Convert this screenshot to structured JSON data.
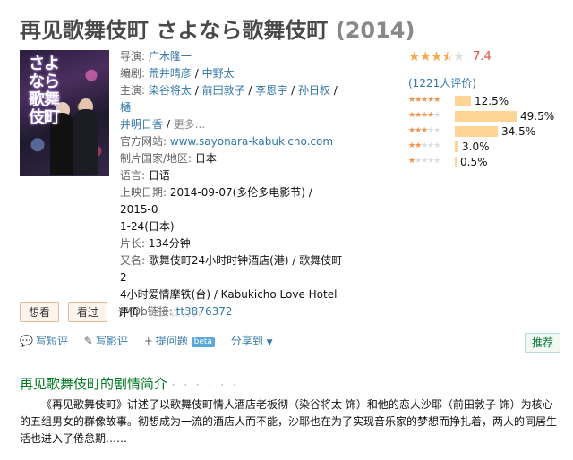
{
  "title": {
    "main": "再见歌舞伎町 さよなら歌舞伎町",
    "year": "(2014)"
  },
  "poster": {
    "text": "さよなら歌舞伎町"
  },
  "info": {
    "director_label": "导演:",
    "director": "广木隆一",
    "writer_label": "编剧:",
    "writers": [
      "荒井晴彦",
      "中野太"
    ],
    "cast_label": "主演:",
    "cast_line1": [
      "染谷将太",
      "前田敦子",
      "李恩宇",
      "孙日权",
      "樋"
    ],
    "cast_line2": [
      "井明日香"
    ],
    "cast_more": "更多...",
    "site_label": "官方网站:",
    "site": "www.sayonara-kabukicho.com",
    "country_label": "制片国家/地区:",
    "country": "日本",
    "lang_label": "语言:",
    "lang": "日语",
    "release_label": "上映日期:",
    "release_line1": "2014-09-07(多伦多电影节) / 2015-0",
    "release_line2": "1-24(日本)",
    "runtime_label": "片长:",
    "runtime": "134分钟",
    "aka_label": "又名:",
    "aka_line1": "歌舞伎町24小时时钟酒店(港) / 歌舞伎町2",
    "aka_line2": "4小时爱情摩铁(台) / Kabukicho Love Hotel",
    "imdb_label": "IMDb链接:",
    "imdb": "tt3876372"
  },
  "rating": {
    "score": "7.4",
    "stars_full": 3.5,
    "votes": "(1221人评价)",
    "distribution": [
      {
        "stars": 5,
        "percent": 12.5,
        "label": "12.5%"
      },
      {
        "stars": 4,
        "percent": 49.5,
        "label": "49.5%"
      },
      {
        "stars": 3,
        "percent": 34.5,
        "label": "34.5%"
      },
      {
        "stars": 2,
        "percent": 3.0,
        "label": "3.0%"
      },
      {
        "stars": 1,
        "percent": 0.5,
        "label": "0.5%"
      }
    ]
  },
  "actions": {
    "want": "想看",
    "seen": "看过",
    "rate_label": "评价:"
  },
  "toolbar": {
    "write_short": "写短评",
    "write_review": "写影评",
    "ask": "提问题",
    "beta": "beta",
    "share": "分享到",
    "recommend": "推荐"
  },
  "intro": {
    "heading": "再见歌舞伎町的剧情简介",
    "dots": "· · · · · ·",
    "text": "《再见歌舞伎町》讲述了以歌舞伎町情人酒店老板彻（染谷将太 饰）和他的恋人沙耶（前田敦子 饰）为核心的五组男女的群像故事。彻想成为一流的酒店人而不能，沙耶也在为了实现音乐家的梦想而挣扎着，两人的同居生活也进入了倦怠期……"
  },
  "colors": {
    "link": "#3377aa",
    "green_heading": "#007722",
    "score": "#e94e3f",
    "star": "#f7a84d",
    "bar": "#ffd596"
  }
}
